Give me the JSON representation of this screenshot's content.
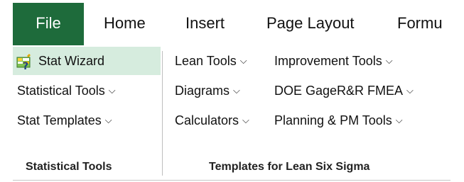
{
  "tabs": {
    "file": "File",
    "home": "Home",
    "insert": "Insert",
    "page_layout": "Page Layout",
    "formu": "Formu"
  },
  "left_group": {
    "stat_wizard": "Stat Wizard",
    "statistical_tools": "Statistical Tools",
    "stat_templates": "Stat Templates",
    "label": "Statistical Tools"
  },
  "right_group": {
    "lean_tools": "Lean Tools",
    "improvement_tools": "Improvement Tools",
    "diagrams": "Diagrams",
    "doe_gage_fmea": "DOE GageR&R FMEA",
    "calculators": "Calculators",
    "planning_pm_tools": "Planning & PM Tools",
    "label": "Templates for Lean Six Sigma"
  },
  "icons": {
    "chevron": "chevron-down-icon",
    "wizard": "stat-wizard-icon"
  },
  "colors": {
    "file_tab": "#1e6b3b",
    "file_text": "#ffffff",
    "hover_highlight": "#d6ecde"
  }
}
